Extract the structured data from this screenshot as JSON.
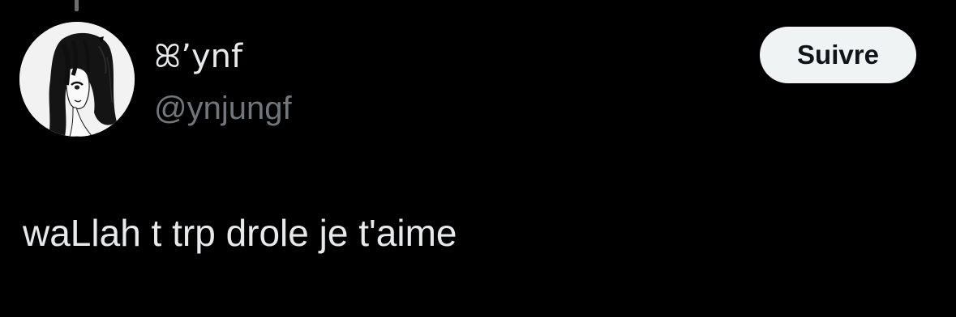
{
  "tweet": {
    "author": {
      "display_name": "ꕤ’ynf",
      "handle": "@ynjungf"
    },
    "follow_label": "Suivre",
    "text": "waLlah t trp drole je t'aime"
  },
  "colors": {
    "background": "#000000",
    "primary_text": "#e7e9ea",
    "secondary_text": "#71767b",
    "button_background": "#eff3f4",
    "button_text": "#0f1419"
  },
  "icons": {
    "avatar": "manga-girl-avatar"
  }
}
